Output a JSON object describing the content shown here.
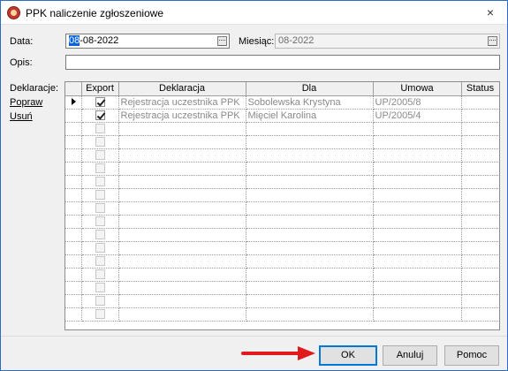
{
  "window": {
    "title": "PPK naliczenie zgłoszeniowe",
    "close_icon": "×"
  },
  "form": {
    "data_label": "Data:",
    "data_value_selected": "08",
    "data_value_rest": "-08-2022",
    "miesiac_label": "Miesiąc:",
    "miesiac_value": "08-2022",
    "opis_label": "Opis:",
    "opis_value": ""
  },
  "side": {
    "deklaracje_label": "Deklaracje:",
    "popraw_link": "Popraw",
    "usun_link": "Usuń"
  },
  "table": {
    "columns": [
      "Export",
      "Deklaracja",
      "Dla",
      "Umowa",
      "Status"
    ],
    "rows": [
      {
        "current": true,
        "export": true,
        "deklaracja": "Rejestracja uczestnika PPK",
        "dla": "Sobolewska Krystyna",
        "umowa": "UP/2005/8",
        "status": ""
      },
      {
        "current": false,
        "export": true,
        "deklaracja": "Rejestracja uczestnika PPK",
        "dla": "Mięciel Karolina",
        "umowa": "UP/2005/4",
        "status": ""
      }
    ],
    "empty_rows": 15
  },
  "buttons": {
    "ok": "OK",
    "anuluj": "Anuluj",
    "pomoc": "Pomoc"
  },
  "colors": {
    "selection": "#0a64d8",
    "annotation_arrow": "#e11b1b",
    "default_button_border": "#0078d7"
  }
}
